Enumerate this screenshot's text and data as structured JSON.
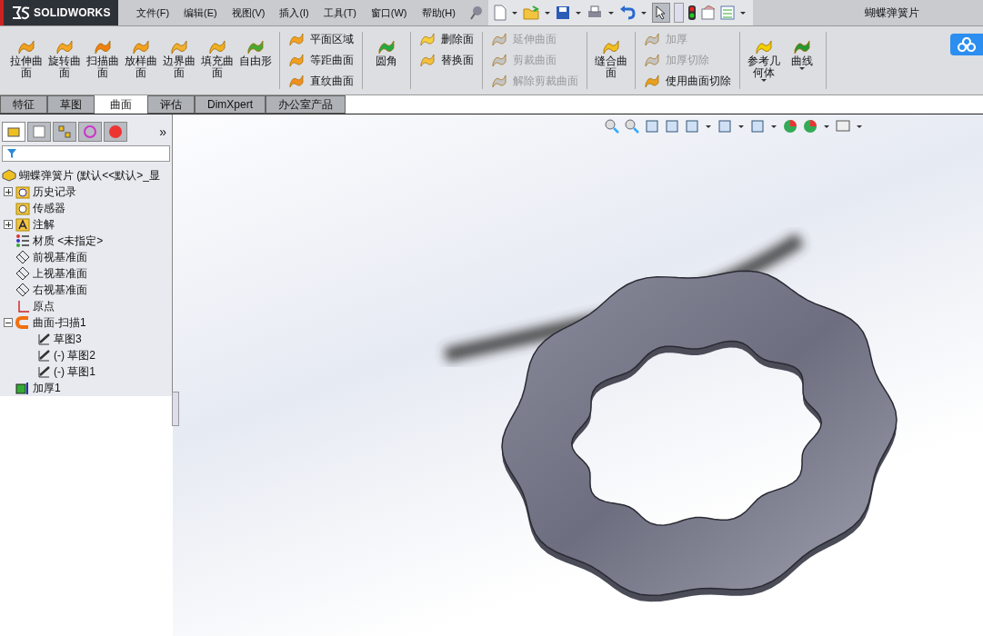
{
  "logo": "SOLIDWORKS",
  "menu": [
    "文件(F)",
    "编辑(E)",
    "视图(V)",
    "插入(I)",
    "工具(T)",
    "窗口(W)",
    "帮助(H)"
  ],
  "document_title": "蝴蝶弹簧片",
  "ribbon": [
    {
      "kind": "large",
      "items": [
        {
          "label": "拉伸曲面",
          "disabled": false,
          "dropdown": false
        },
        {
          "label": "旋转曲面",
          "disabled": false,
          "dropdown": false
        },
        {
          "label": "扫描曲面",
          "disabled": false,
          "dropdown": false
        },
        {
          "label": "放样曲面",
          "disabled": false,
          "dropdown": false
        },
        {
          "label": "边界曲面",
          "disabled": false,
          "dropdown": false
        },
        {
          "label": "填充曲面",
          "disabled": false,
          "dropdown": false
        },
        {
          "label": "自由形",
          "disabled": false,
          "dropdown": false
        }
      ]
    },
    {
      "kind": "stack",
      "items": [
        {
          "label": "平面区域",
          "disabled": false
        },
        {
          "label": "等距曲面",
          "disabled": false
        },
        {
          "label": "直纹曲面",
          "disabled": false
        }
      ]
    },
    {
      "kind": "large",
      "items": [
        {
          "label": "圆角",
          "disabled": false,
          "dropdown": false
        }
      ]
    },
    {
      "kind": "stack",
      "items": [
        {
          "label": "删除面",
          "disabled": false
        },
        {
          "label": "替换面",
          "disabled": false
        }
      ]
    },
    {
      "kind": "stack",
      "items": [
        {
          "label": "延伸曲面",
          "disabled": true
        },
        {
          "label": "剪裁曲面",
          "disabled": true
        },
        {
          "label": "解除剪裁曲面",
          "disabled": true
        }
      ]
    },
    {
      "kind": "large",
      "items": [
        {
          "label": "缝合曲面",
          "disabled": false,
          "dropdown": false
        }
      ]
    },
    {
      "kind": "stack",
      "items": [
        {
          "label": "加厚",
          "disabled": true
        },
        {
          "label": "加厚切除",
          "disabled": true
        },
        {
          "label": "使用曲面切除",
          "disabled": false
        }
      ]
    },
    {
      "kind": "large",
      "items": [
        {
          "label": "参考几何体",
          "disabled": false,
          "dropdown": true
        },
        {
          "label": "曲线",
          "disabled": false,
          "dropdown": true
        }
      ]
    }
  ],
  "command_tabs": [
    {
      "label": "特征",
      "selected": false
    },
    {
      "label": "草图",
      "selected": false
    },
    {
      "label": "曲面",
      "selected": true
    },
    {
      "label": "评估",
      "selected": false
    },
    {
      "label": "DimXpert",
      "selected": false
    },
    {
      "label": "办公室产品",
      "selected": false
    }
  ],
  "panel_tabs": [
    {
      "selected": true
    },
    {
      "selected": false
    },
    {
      "selected": false
    },
    {
      "selected": false
    },
    {
      "selected": false
    }
  ],
  "panel_more": "»",
  "tree": {
    "label": "蝴蝶弹簧片  (默认<<默认>_显",
    "children": [
      {
        "label": "历史记录",
        "kind": "history",
        "expanded": false
      },
      {
        "label": "传感器",
        "kind": "sensor"
      },
      {
        "label": "注解",
        "kind": "annotation",
        "expanded": false
      },
      {
        "label": "材质 <未指定>",
        "kind": "material"
      },
      {
        "label": "前视基准面",
        "kind": "plane"
      },
      {
        "label": "上视基准面",
        "kind": "plane"
      },
      {
        "label": "右视基准面",
        "kind": "plane"
      },
      {
        "label": "原点",
        "kind": "origin"
      },
      {
        "label": "曲面-扫描1",
        "kind": "sweep",
        "expanded": true,
        "children": [
          {
            "label": "草图3"
          },
          {
            "label": "(-) 草图2"
          },
          {
            "label": "(-) 草图1"
          }
        ]
      },
      {
        "label": "加厚1",
        "kind": "thicken"
      }
    ]
  }
}
